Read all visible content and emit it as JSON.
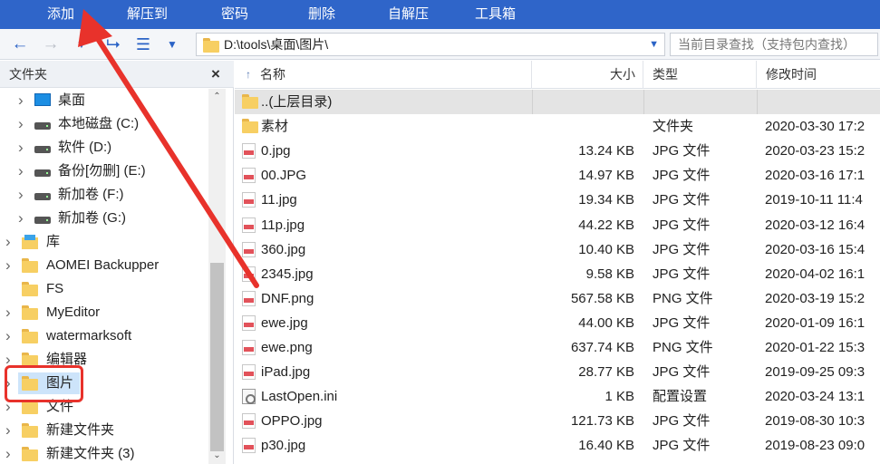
{
  "toolbar": {
    "add": "添加",
    "extract_to": "解压到",
    "password": "密码",
    "delete": "删除",
    "self_extract": "自解压",
    "toolbox": "工具箱"
  },
  "nav": {
    "address": "D:\\tools\\桌面\\图片\\",
    "search_placeholder": "当前目录查找（支持包内查找）"
  },
  "left_pane": {
    "title": "文件夹",
    "close": "×",
    "tree": [
      {
        "label": "桌面",
        "icon": "desktop-icon"
      },
      {
        "label": "本地磁盘 (C:)",
        "icon": "system-drive-icon"
      },
      {
        "label": "软件 (D:)",
        "icon": "drive-icon"
      },
      {
        "label": "备份[勿删] (E:)",
        "icon": "drive-icon"
      },
      {
        "label": "新加卷 (F:)",
        "icon": "drive-icon"
      },
      {
        "label": "新加卷 (G:)",
        "icon": "drive-icon"
      },
      {
        "label": "库",
        "icon": "library-icon"
      },
      {
        "label": "AOMEI Backupper",
        "icon": "folder-icon"
      },
      {
        "label": "FS",
        "icon": "folder-icon"
      },
      {
        "label": "MyEditor",
        "icon": "folder-icon"
      },
      {
        "label": "watermarksoft",
        "icon": "folder-icon"
      },
      {
        "label": "编辑器",
        "icon": "folder-icon"
      },
      {
        "label": "图片",
        "icon": "folder-icon"
      },
      {
        "label": "文件",
        "icon": "folder-icon"
      },
      {
        "label": "新建文件夹",
        "icon": "folder-icon"
      },
      {
        "label": "新建文件夹 (3)",
        "icon": "folder-icon"
      }
    ],
    "selected": "图片"
  },
  "file_list": {
    "columns": {
      "name": "名称",
      "size": "大小",
      "type": "类型",
      "modified": "修改时间"
    },
    "rows": [
      {
        "name": "..(上层目录)",
        "size": "",
        "type": "",
        "modified": "",
        "icon": "folder-icon"
      },
      {
        "name": "素材",
        "size": "",
        "type": "文件夹",
        "modified": "2020-03-30 17:2",
        "icon": "folder-icon"
      },
      {
        "name": "0.jpg",
        "size": "13.24 KB",
        "type": "JPG 文件",
        "modified": "2020-03-23 15:2",
        "icon": "image-file-icon"
      },
      {
        "name": "00.JPG",
        "size": "14.97 KB",
        "type": "JPG 文件",
        "modified": "2020-03-16 17:1",
        "icon": "image-file-icon"
      },
      {
        "name": "11.jpg",
        "size": "19.34 KB",
        "type": "JPG 文件",
        "modified": "2019-10-11 11:4",
        "icon": "image-file-icon"
      },
      {
        "name": "11p.jpg",
        "size": "44.22 KB",
        "type": "JPG 文件",
        "modified": "2020-03-12 16:4",
        "icon": "image-file-icon"
      },
      {
        "name": "360.jpg",
        "size": "10.40 KB",
        "type": "JPG 文件",
        "modified": "2020-03-16 15:4",
        "icon": "image-file-icon"
      },
      {
        "name": "2345.jpg",
        "size": "9.58 KB",
        "type": "JPG 文件",
        "modified": "2020-04-02 16:1",
        "icon": "image-file-icon"
      },
      {
        "name": "DNF.png",
        "size": "567.58 KB",
        "type": "PNG 文件",
        "modified": "2020-03-19 15:2",
        "icon": "image-file-icon"
      },
      {
        "name": "ewe.jpg",
        "size": "44.00 KB",
        "type": "JPG 文件",
        "modified": "2020-01-09 16:1",
        "icon": "image-file-icon"
      },
      {
        "name": "ewe.png",
        "size": "637.74 KB",
        "type": "PNG 文件",
        "modified": "2020-01-22 15:3",
        "icon": "image-file-icon"
      },
      {
        "name": "iPad.jpg",
        "size": "28.77 KB",
        "type": "JPG 文件",
        "modified": "2019-09-25 09:3",
        "icon": "image-file-icon"
      },
      {
        "name": "LastOpen.ini",
        "size": "1 KB",
        "type": "配置设置",
        "modified": "2020-03-24 13:1",
        "icon": "ini-file-icon"
      },
      {
        "name": "OPPO.jpg",
        "size": "121.73 KB",
        "type": "JPG 文件",
        "modified": "2019-08-30 10:3",
        "icon": "image-file-icon"
      },
      {
        "name": "p30.jpg",
        "size": "16.40 KB",
        "type": "JPG 文件",
        "modified": "2019-08-23 09:0",
        "icon": "image-file-icon"
      }
    ]
  },
  "colors": {
    "toolbar_bg": "#2f65c9",
    "annotation_red": "#e8322b",
    "selection_bg": "#cde4fa"
  }
}
